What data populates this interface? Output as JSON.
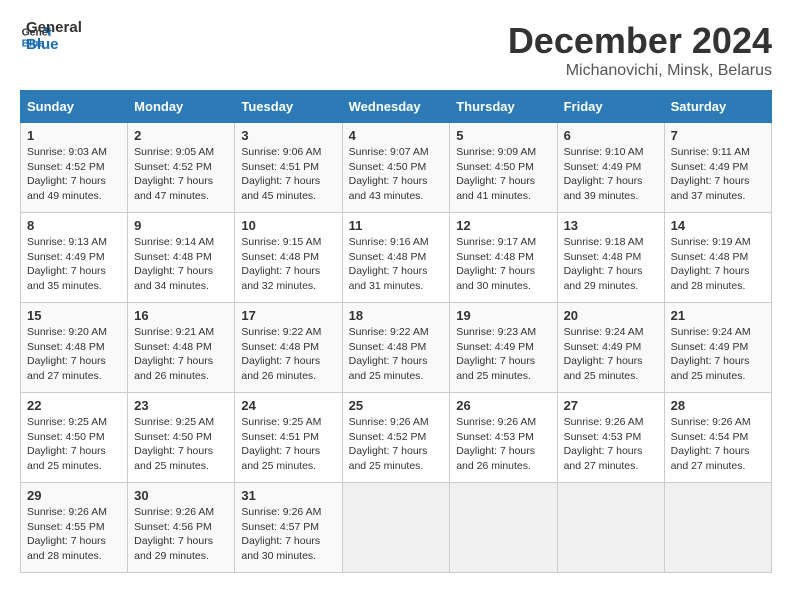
{
  "logo": {
    "line1": "General",
    "line2": "Blue"
  },
  "title": "December 2024",
  "location": "Michanovichi, Minsk, Belarus",
  "days_of_week": [
    "Sunday",
    "Monday",
    "Tuesday",
    "Wednesday",
    "Thursday",
    "Friday",
    "Saturday"
  ],
  "weeks": [
    [
      {
        "day": "1",
        "sunrise": "9:03 AM",
        "sunset": "4:52 PM",
        "daylight": "7 hours and 49 minutes."
      },
      {
        "day": "2",
        "sunrise": "9:05 AM",
        "sunset": "4:52 PM",
        "daylight": "7 hours and 47 minutes."
      },
      {
        "day": "3",
        "sunrise": "9:06 AM",
        "sunset": "4:51 PM",
        "daylight": "7 hours and 45 minutes."
      },
      {
        "day": "4",
        "sunrise": "9:07 AM",
        "sunset": "4:50 PM",
        "daylight": "7 hours and 43 minutes."
      },
      {
        "day": "5",
        "sunrise": "9:09 AM",
        "sunset": "4:50 PM",
        "daylight": "7 hours and 41 minutes."
      },
      {
        "day": "6",
        "sunrise": "9:10 AM",
        "sunset": "4:49 PM",
        "daylight": "7 hours and 39 minutes."
      },
      {
        "day": "7",
        "sunrise": "9:11 AM",
        "sunset": "4:49 PM",
        "daylight": "7 hours and 37 minutes."
      }
    ],
    [
      {
        "day": "8",
        "sunrise": "9:13 AM",
        "sunset": "4:49 PM",
        "daylight": "7 hours and 35 minutes."
      },
      {
        "day": "9",
        "sunrise": "9:14 AM",
        "sunset": "4:48 PM",
        "daylight": "7 hours and 34 minutes."
      },
      {
        "day": "10",
        "sunrise": "9:15 AM",
        "sunset": "4:48 PM",
        "daylight": "7 hours and 32 minutes."
      },
      {
        "day": "11",
        "sunrise": "9:16 AM",
        "sunset": "4:48 PM",
        "daylight": "7 hours and 31 minutes."
      },
      {
        "day": "12",
        "sunrise": "9:17 AM",
        "sunset": "4:48 PM",
        "daylight": "7 hours and 30 minutes."
      },
      {
        "day": "13",
        "sunrise": "9:18 AM",
        "sunset": "4:48 PM",
        "daylight": "7 hours and 29 minutes."
      },
      {
        "day": "14",
        "sunrise": "9:19 AM",
        "sunset": "4:48 PM",
        "daylight": "7 hours and 28 minutes."
      }
    ],
    [
      {
        "day": "15",
        "sunrise": "9:20 AM",
        "sunset": "4:48 PM",
        "daylight": "7 hours and 27 minutes."
      },
      {
        "day": "16",
        "sunrise": "9:21 AM",
        "sunset": "4:48 PM",
        "daylight": "7 hours and 26 minutes."
      },
      {
        "day": "17",
        "sunrise": "9:22 AM",
        "sunset": "4:48 PM",
        "daylight": "7 hours and 26 minutes."
      },
      {
        "day": "18",
        "sunrise": "9:22 AM",
        "sunset": "4:48 PM",
        "daylight": "7 hours and 25 minutes."
      },
      {
        "day": "19",
        "sunrise": "9:23 AM",
        "sunset": "4:49 PM",
        "daylight": "7 hours and 25 minutes."
      },
      {
        "day": "20",
        "sunrise": "9:24 AM",
        "sunset": "4:49 PM",
        "daylight": "7 hours and 25 minutes."
      },
      {
        "day": "21",
        "sunrise": "9:24 AM",
        "sunset": "4:49 PM",
        "daylight": "7 hours and 25 minutes."
      }
    ],
    [
      {
        "day": "22",
        "sunrise": "9:25 AM",
        "sunset": "4:50 PM",
        "daylight": "7 hours and 25 minutes."
      },
      {
        "day": "23",
        "sunrise": "9:25 AM",
        "sunset": "4:50 PM",
        "daylight": "7 hours and 25 minutes."
      },
      {
        "day": "24",
        "sunrise": "9:25 AM",
        "sunset": "4:51 PM",
        "daylight": "7 hours and 25 minutes."
      },
      {
        "day": "25",
        "sunrise": "9:26 AM",
        "sunset": "4:52 PM",
        "daylight": "7 hours and 25 minutes."
      },
      {
        "day": "26",
        "sunrise": "9:26 AM",
        "sunset": "4:53 PM",
        "daylight": "7 hours and 26 minutes."
      },
      {
        "day": "27",
        "sunrise": "9:26 AM",
        "sunset": "4:53 PM",
        "daylight": "7 hours and 27 minutes."
      },
      {
        "day": "28",
        "sunrise": "9:26 AM",
        "sunset": "4:54 PM",
        "daylight": "7 hours and 27 minutes."
      }
    ],
    [
      {
        "day": "29",
        "sunrise": "9:26 AM",
        "sunset": "4:55 PM",
        "daylight": "7 hours and 28 minutes."
      },
      {
        "day": "30",
        "sunrise": "9:26 AM",
        "sunset": "4:56 PM",
        "daylight": "7 hours and 29 minutes."
      },
      {
        "day": "31",
        "sunrise": "9:26 AM",
        "sunset": "4:57 PM",
        "daylight": "7 hours and 30 minutes."
      },
      null,
      null,
      null,
      null
    ]
  ]
}
